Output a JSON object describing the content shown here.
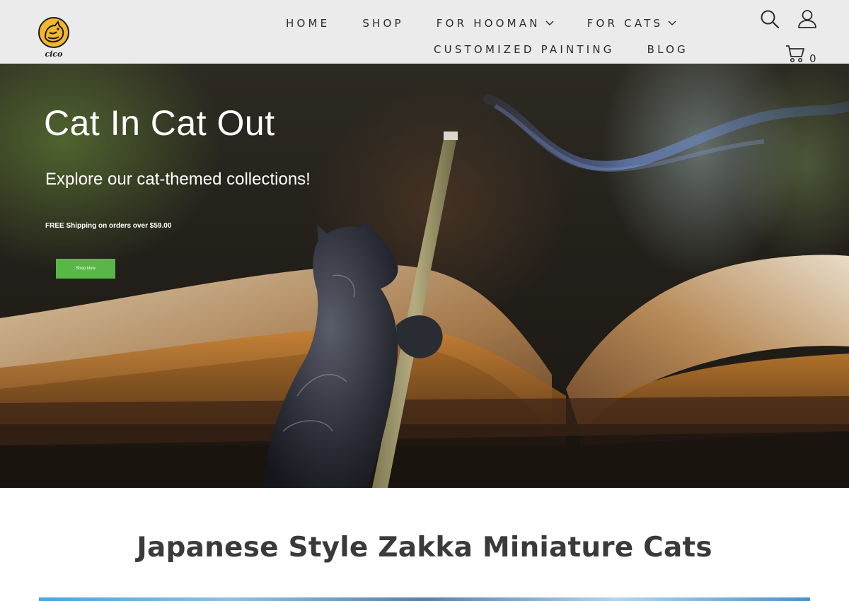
{
  "header": {
    "logo_text": "cico",
    "nav_row1": [
      {
        "label": "HOME",
        "has_dropdown": false
      },
      {
        "label": "SHOP",
        "has_dropdown": false
      },
      {
        "label": "FOR HOOMAN",
        "has_dropdown": true
      },
      {
        "label": "FOR CATS",
        "has_dropdown": true
      }
    ],
    "nav_row2": [
      {
        "label": "CUSTOMIZED PAINTING",
        "has_dropdown": false
      },
      {
        "label": "BLOG",
        "has_dropdown": false
      }
    ],
    "icons": [
      "search-icon",
      "account-icon",
      "cart-icon"
    ],
    "cart_count": "0"
  },
  "hero": {
    "title": "Cat In Cat Out",
    "subtitle": "Explore our cat-themed collections!",
    "shipping_note": "FREE Shipping on orders over $59.00",
    "button_label": "Shop Now"
  },
  "section": {
    "title": "Japanese Style Zakka Miniature Cats"
  },
  "colors": {
    "header_bg": "#ebebeb",
    "button_green": "#58b745",
    "title_gray": "#3a3a3a",
    "logo_yellow": "#f2b630"
  }
}
